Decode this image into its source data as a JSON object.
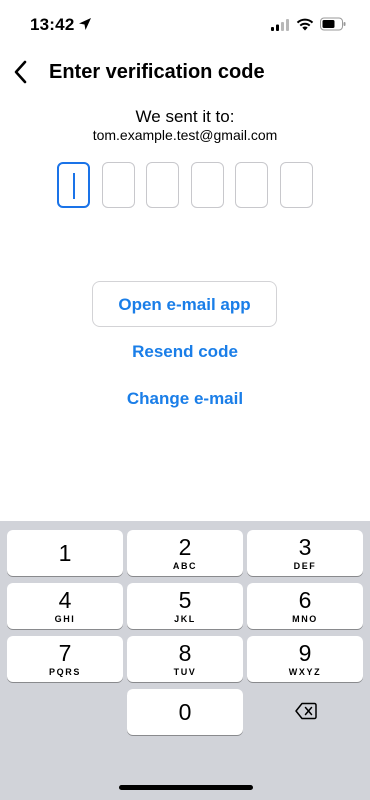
{
  "status_bar": {
    "time": "13:42",
    "icons": [
      "location-arrow-icon",
      "signal-icon",
      "wifi-icon",
      "battery-icon"
    ]
  },
  "header": {
    "back_icon": "chevron-left-icon",
    "title": "Enter verification code"
  },
  "verification": {
    "sent_label": "We sent it to:",
    "email": "tom.example.test@gmail.com",
    "code_digits": [
      "",
      "",
      "",
      "",
      "",
      ""
    ],
    "active_index": 0
  },
  "actions": {
    "open_email_label": "Open e-mail app",
    "resend_label": "Resend code",
    "change_email_label": "Change e-mail"
  },
  "keypad": {
    "keys": [
      {
        "num": "1",
        "letters": ""
      },
      {
        "num": "2",
        "letters": "ABC"
      },
      {
        "num": "3",
        "letters": "DEF"
      },
      {
        "num": "4",
        "letters": "GHI"
      },
      {
        "num": "5",
        "letters": "JKL"
      },
      {
        "num": "6",
        "letters": "MNO"
      },
      {
        "num": "7",
        "letters": "PQRS"
      },
      {
        "num": "8",
        "letters": "TUV"
      },
      {
        "num": "9",
        "letters": "WXYZ"
      },
      {
        "num": "0",
        "letters": ""
      }
    ],
    "delete_icon": "backspace-icon"
  },
  "colors": {
    "accent": "#1a7ee8",
    "keypad_bg": "#d1d3d9",
    "box_border": "#c8c8cc"
  }
}
